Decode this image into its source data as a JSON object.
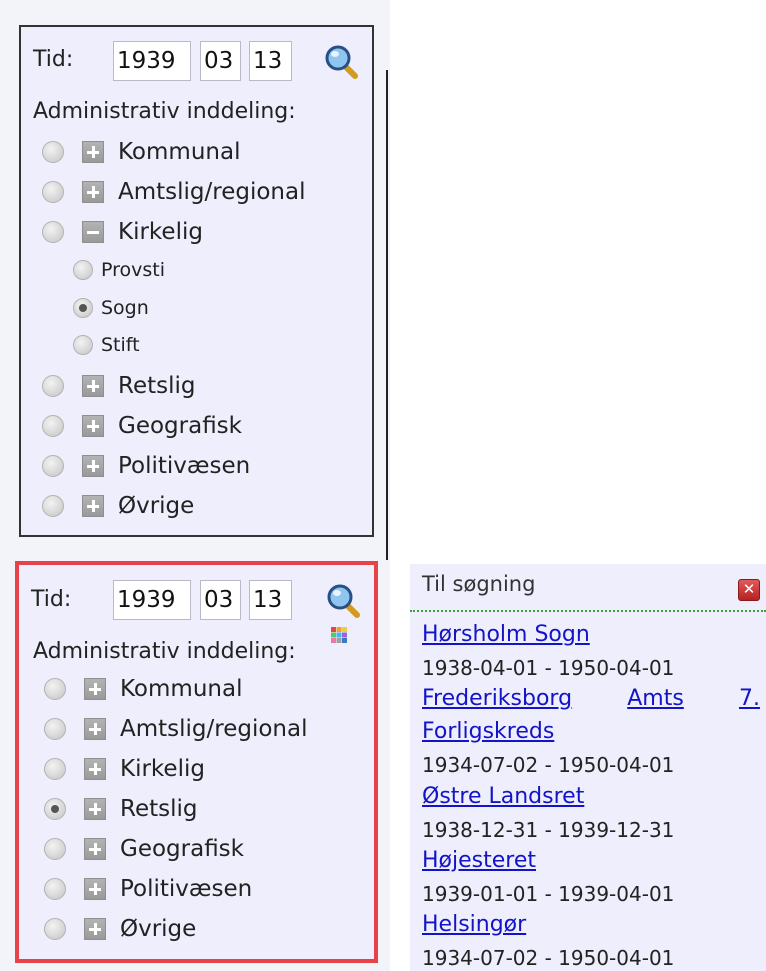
{
  "panel_top": {
    "time_label": "Tid:",
    "year": "1939",
    "month": "03",
    "day": "13",
    "admin_label": "Administrativ inddeling:",
    "items": [
      {
        "label": "Kommunal"
      },
      {
        "label": "Amtslig/regional"
      },
      {
        "label": "Kirkelig",
        "expanded": true
      },
      {
        "label": "Provsti"
      },
      {
        "label": "Sogn",
        "selected": true
      },
      {
        "label": "Stift"
      },
      {
        "label": "Retslig"
      },
      {
        "label": "Geografisk"
      },
      {
        "label": "Politivæsen"
      },
      {
        "label": "Øvrige"
      }
    ]
  },
  "panel_bottom": {
    "time_label": "Tid:",
    "year": "1939",
    "month": "03",
    "day": "13",
    "admin_label": "Administrativ inddeling:",
    "items": [
      {
        "label": "Kommunal"
      },
      {
        "label": "Amtslig/regional"
      },
      {
        "label": "Kirkelig"
      },
      {
        "label": "Retslig",
        "selected": true
      },
      {
        "label": "Geografisk"
      },
      {
        "label": "Politivæsen"
      },
      {
        "label": "Øvrige"
      }
    ]
  },
  "search_panel": {
    "title": "Til søgning",
    "results": [
      {
        "name": "Hørsholm Sogn",
        "dates": "1938-04-01 - 1950-04-01"
      },
      {
        "name_words": [
          "Frederiksborg",
          "Amts",
          "7."
        ],
        "name_line2": "Forligskreds",
        "dates": "1934-07-02 - 1950-04-01"
      },
      {
        "name": "Østre Landsret",
        "dates": "1938-12-31 - 1939-12-31"
      },
      {
        "name": "Højesteret",
        "dates": "1939-01-01 - 1939-04-01"
      },
      {
        "name": "Helsingør",
        "dates": "1934-07-02 - 1950-04-01"
      }
    ]
  },
  "colors": {
    "highlight_border": "#e5424a",
    "link": "#1313c8",
    "panel_bg": "#eeeefc",
    "separator": "#3aa03a"
  }
}
